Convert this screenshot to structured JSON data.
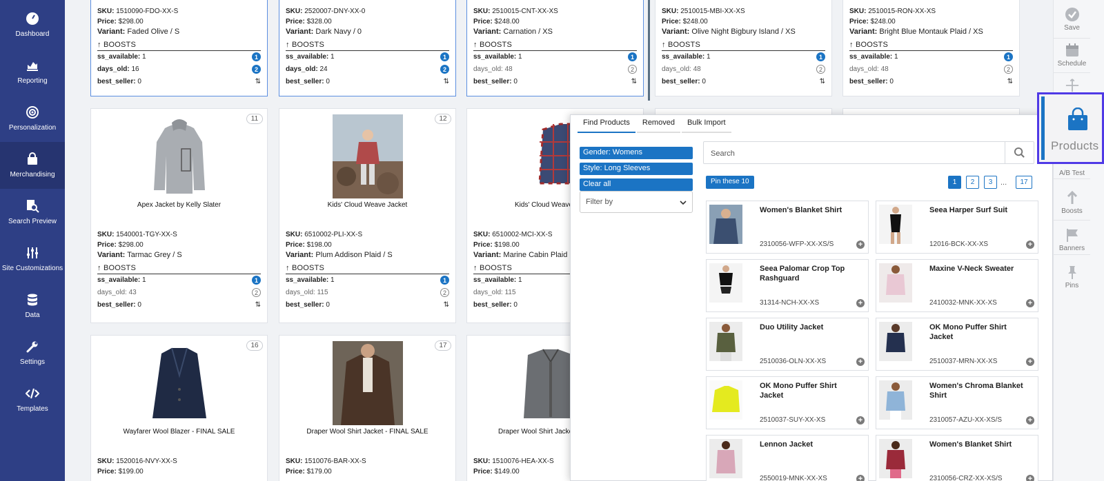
{
  "nav": [
    {
      "label": "Dashboard",
      "icon": "dashboard-icon"
    },
    {
      "label": "Reporting",
      "icon": "chart-icon"
    },
    {
      "label": "Personalization",
      "icon": "target-icon"
    },
    {
      "label": "Merchandising",
      "icon": "bag-icon"
    },
    {
      "label": "Search Preview",
      "icon": "search-doc-icon"
    },
    {
      "label": "Site Customizations",
      "icon": "sliders-icon"
    },
    {
      "label": "Data",
      "icon": "database-icon"
    },
    {
      "label": "Settings",
      "icon": "wrench-icon"
    },
    {
      "label": "Templates",
      "icon": "code-icon"
    }
  ],
  "labels": {
    "sku": "SKU:",
    "price": "Price:",
    "variant": "Variant:",
    "boosts": "BOOSTS",
    "ss_available": "ss_available:",
    "days_old": "days_old:",
    "best_seller": "best_seller:"
  },
  "top_row": [
    {
      "sku": "1510090-FDO-XX-S",
      "price": "$298.00",
      "variant": "Faded Olive / S",
      "ss": "1",
      "days": "16",
      "best": "0",
      "ss_badge": "1",
      "days_badge": "2",
      "days_filled": true
    },
    {
      "sku": "2520007-DNY-XX-0",
      "price": "$328.00",
      "variant": "Dark Navy / 0",
      "ss": "1",
      "days": "24",
      "best": "0",
      "ss_badge": "1",
      "days_badge": "2",
      "days_filled": true
    },
    {
      "sku": "2510015-CNT-XX-XS",
      "price": "$248.00",
      "variant": "Carnation / XS",
      "ss": "1",
      "days": "48",
      "best": "0",
      "ss_badge": "1",
      "days_badge": "2",
      "days_filled": false
    },
    {
      "sku": "2510015-MBI-XX-XS",
      "price": "$248.00",
      "variant": "Olive Night Bigbury Island / XS",
      "ss": "1",
      "days": "48",
      "best": "0",
      "ss_badge": "1",
      "days_badge": "2",
      "days_filled": false
    },
    {
      "sku": "2510015-RON-XX-XS",
      "price": "$248.00",
      "variant": "Bright Blue Montauk Plaid / XS",
      "ss": "1",
      "days": "48",
      "best": "0",
      "ss_badge": "1",
      "days_badge": "2",
      "days_filled": false
    }
  ],
  "mid_row": [
    {
      "num": "11",
      "name": "Apex Jacket by Kelly Slater",
      "sku": "1540001-TGY-XX-S",
      "price": "$298.00",
      "variant": "Tarmac Grey / S",
      "ss": "1",
      "days": "43",
      "best": "0",
      "ss_badge": "1",
      "days_badge": "2"
    },
    {
      "num": "12",
      "name": "Kids' Cloud Weave Jacket",
      "sku": "6510002-PLI-XX-S",
      "price": "$198.00",
      "variant": "Plum Addison Plaid / S",
      "ss": "1",
      "days": "115",
      "best": "0",
      "ss_badge": "1",
      "days_badge": "2"
    },
    {
      "num": "",
      "name": "Kids' Cloud Weave",
      "sku": "6510002-MCI-XX-S",
      "price": "$198.00",
      "variant": "Marine Cabin Plaid",
      "ss": "1",
      "days": "115",
      "best": "0",
      "ss_badge": "",
      "days_badge": ""
    }
  ],
  "bottom_row": [
    {
      "num": "16",
      "name": "Wayfarer Wool Blazer - FINAL SALE",
      "sku": "1520016-NVY-XX-S",
      "price": "$199.00"
    },
    {
      "num": "17",
      "name": "Draper Wool Shirt Jacket - FINAL SALE",
      "sku": "1510076-BAR-XX-S",
      "price": "$179.00"
    },
    {
      "num": "",
      "name": "Draper Wool Shirt Jacke",
      "sku": "1510076-HEA-XX-S",
      "price": "$149.00"
    }
  ],
  "panel": {
    "tabs": [
      "Find Products",
      "Removed",
      "Bulk Import"
    ],
    "chips": [
      "Gender: Womens",
      "Style: Long Sleeves",
      "Clear all"
    ],
    "filter_placeholder": "Filter by",
    "search_placeholder": "Search",
    "pin_label": "Pin these 10",
    "pages": [
      "1",
      "2",
      "3",
      "17"
    ],
    "ellipsis": "...",
    "results": [
      {
        "name": "Women's Blanket Shirt",
        "sku": "2310056-WFP-XX-XS/S"
      },
      {
        "name": "Seea Harper Surf Suit",
        "sku": "12016-BCK-XX-XS"
      },
      {
        "name": "Seea Palomar Crop Top Rashguard",
        "sku": "31314-NCH-XX-XS"
      },
      {
        "name": "Maxine V-Neck Sweater",
        "sku": "2410032-MNK-XX-XS"
      },
      {
        "name": "Duo Utility Jacket",
        "sku": "2510036-OLN-XX-XS"
      },
      {
        "name": "OK Mono Puffer Shirt Jacket",
        "sku": "2510037-MRN-XX-XS"
      },
      {
        "name": "OK Mono Puffer Shirt Jacket",
        "sku": "2510037-SUY-XX-XS"
      },
      {
        "name": "Women's Chroma Blanket Shirt",
        "sku": "2310057-AZU-XX-XS/S"
      },
      {
        "name": "Lennon Jacket",
        "sku": "2550019-MNK-XX-XS"
      },
      {
        "name": "Women's Blanket Shirt",
        "sku": "2310056-CRZ-XX-XS/S"
      }
    ]
  },
  "rightbar": [
    {
      "label": "Save",
      "icon": "check-circle-icon"
    },
    {
      "label": "Schedule",
      "icon": "calendar-icon"
    },
    {
      "label": "A/B Test",
      "icon": "ab-test-icon"
    },
    {
      "label": "Boosts",
      "icon": "arrow-up-icon"
    },
    {
      "label": "Banners",
      "icon": "flag-icon"
    },
    {
      "label": "Pins",
      "icon": "pin-icon"
    }
  ],
  "products_label": "Products",
  "colors": {
    "nav_bg": "#2e3f85",
    "accent": "#1b74c4",
    "highlight": "#4f39e6"
  }
}
